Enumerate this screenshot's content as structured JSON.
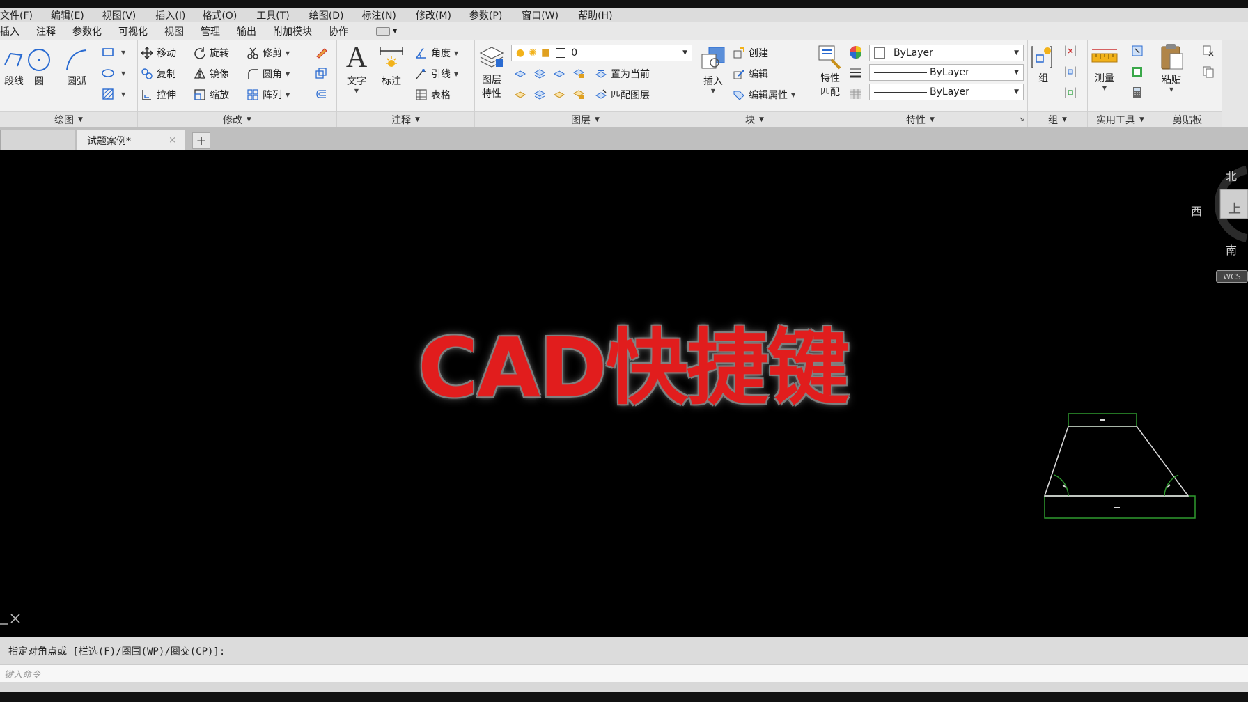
{
  "menu": [
    "文件(F)",
    "编辑(E)",
    "视图(V)",
    "插入(I)",
    "格式(O)",
    "工具(T)",
    "绘图(D)",
    "标注(N)",
    "修改(M)",
    "参数(P)",
    "窗口(W)",
    "帮助(H)"
  ],
  "ribbon_tabs": [
    "插入",
    "注释",
    "参数化",
    "可视化",
    "视图",
    "管理",
    "输出",
    "附加模块",
    "协作"
  ],
  "panels": {
    "draw": {
      "title": "绘图",
      "polyline": "段线",
      "circle": "圆",
      "arc": "圆弧"
    },
    "modify": {
      "title": "修改",
      "move": "移动",
      "rotate": "旋转",
      "trim": "修剪",
      "copy": "复制",
      "mirror": "镜像",
      "fillet": "圆角",
      "stretch": "拉伸",
      "scale": "缩放",
      "array": "阵列"
    },
    "annotate": {
      "title": "注释",
      "text": "文字",
      "dimension": "标注",
      "angle": "角度",
      "leader": "引线",
      "table": "表格"
    },
    "layers": {
      "title": "图层",
      "layer_props_1": "图层",
      "layer_props_2": "特性",
      "layer_value": "0",
      "set_current": "置为当前",
      "match_layer": "匹配图层"
    },
    "block": {
      "title": "块",
      "insert": "插入",
      "create": "创建",
      "edit": "编辑",
      "edit_attr": "编辑属性"
    },
    "properties": {
      "title": "特性",
      "match_1": "特性",
      "match_2": "匹配",
      "color": "ByLayer",
      "linetype": "ByLayer",
      "lineweight": "ByLayer"
    },
    "groups": {
      "title": "组",
      "group": "组"
    },
    "utilities": {
      "title": "实用工具",
      "measure": "测量"
    },
    "clipboard": {
      "title": "剪贴板",
      "paste": "粘贴"
    }
  },
  "doc_tab": {
    "label": "试题案例*",
    "close": "×",
    "new": "+"
  },
  "overlay_title": "CAD快捷键",
  "viewcube": {
    "north": "北",
    "west": "西",
    "south": "南",
    "face": "上",
    "wcs": "WCS"
  },
  "command": {
    "history": "指定对角点或 [栏选(F)/圈围(WP)/圈交(CP)]:",
    "placeholder": "键入命令"
  },
  "colors": {
    "overlay_red": "#e11d1d",
    "drawing_line": "#d8d8d8",
    "dimension_green": "#2f9a2f"
  }
}
